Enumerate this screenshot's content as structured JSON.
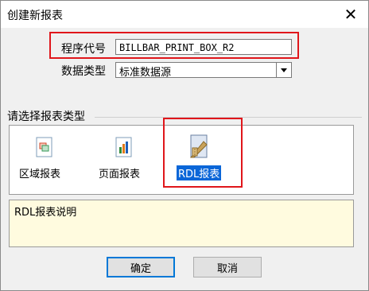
{
  "window": {
    "title": "创建新报表",
    "close_glyph": "✕"
  },
  "form": {
    "code_label": "程序代号",
    "code_value": "BILLBAR_PRINT_BOX_R2",
    "datatype_label": "数据类型",
    "datatype_value": "标准数据源"
  },
  "types": {
    "group_label": "请选择报表类型",
    "items": [
      {
        "label": "区域报表",
        "icon": "region-report-icon"
      },
      {
        "label": "页面报表",
        "icon": "page-report-icon"
      },
      {
        "label": "RDL报表",
        "icon": "rdl-report-icon",
        "selected": true
      }
    ]
  },
  "description": {
    "text": "RDL报表说明"
  },
  "buttons": {
    "ok": "确定",
    "cancel": "取消"
  },
  "colors": {
    "highlight_red": "#e0161b",
    "selection_blue": "#0a66d8",
    "desc_bg": "#fffbdf"
  }
}
